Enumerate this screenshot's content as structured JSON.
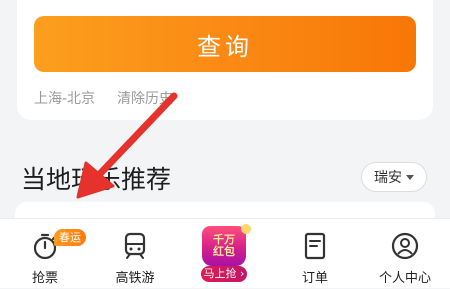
{
  "search": {
    "button_label": "查询",
    "history": [
      "上海-北京",
      "清除历史"
    ]
  },
  "recommend": {
    "title": "当地玩乐推荐",
    "city": "瑞安"
  },
  "tabbar": {
    "items": [
      {
        "label": "抢票",
        "icon": "stopwatch-icon",
        "badge": "春运"
      },
      {
        "label": "高铁游",
        "icon": "train-icon"
      },
      {
        "label": "",
        "icon": "red-envelope-icon"
      },
      {
        "label": "订单",
        "icon": "order-icon"
      },
      {
        "label": "个人中心",
        "icon": "user-icon"
      }
    ],
    "promo": {
      "line1": "千万",
      "line2": "红包",
      "action": "马上抢 ›"
    }
  },
  "colors": {
    "accent": "#fb8a14",
    "annotation_arrow": "#e5322d",
    "promo": "#d6208c"
  }
}
